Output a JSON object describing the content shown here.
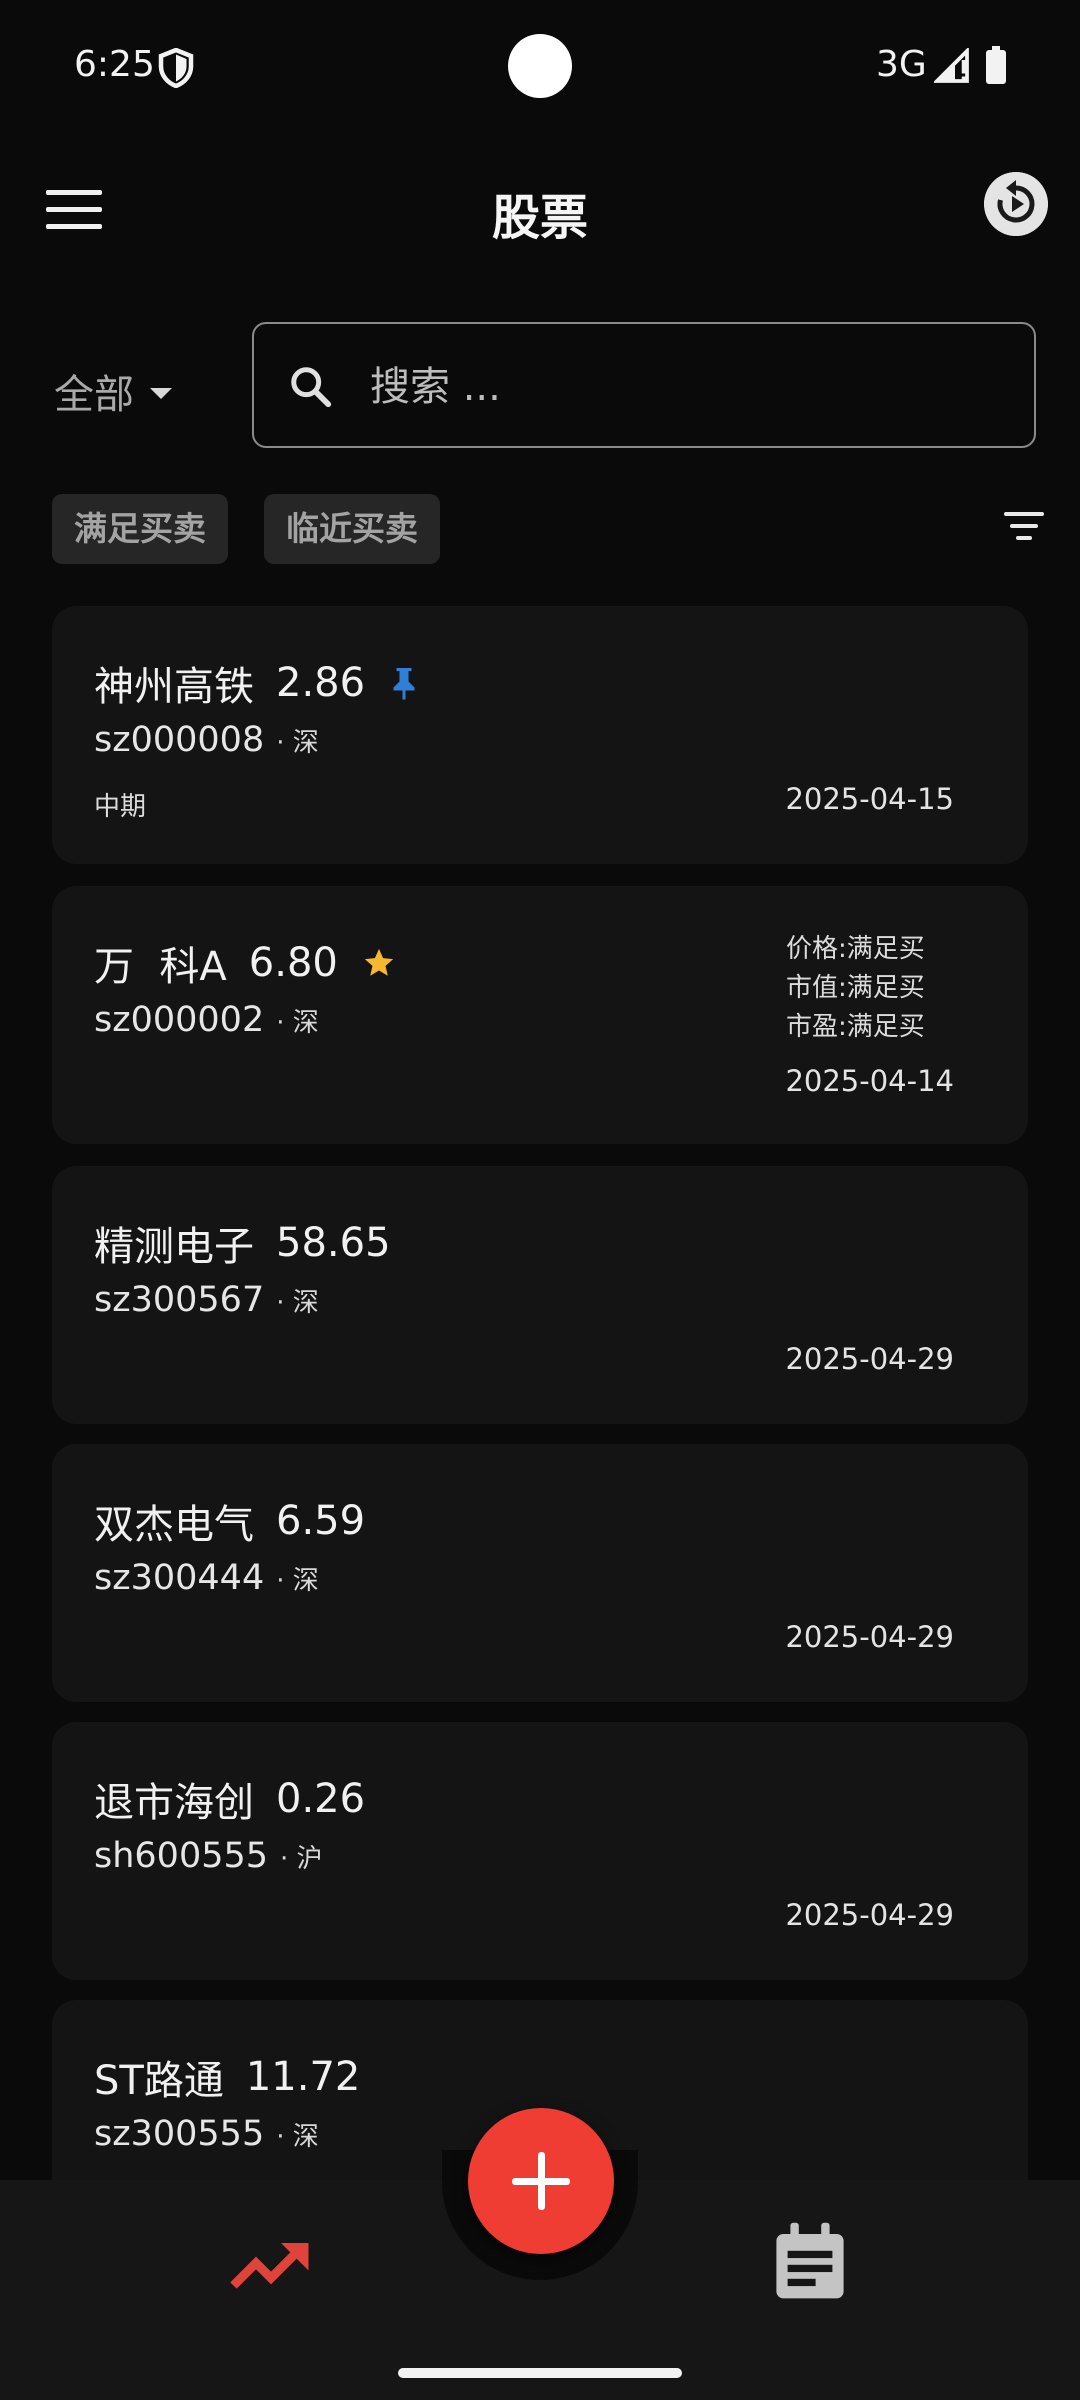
{
  "status_bar": {
    "time": "6:25",
    "network": "3G"
  },
  "app_bar": {
    "title": "股票"
  },
  "filter": {
    "selected": "全部"
  },
  "search": {
    "placeholder": "搜索 ..."
  },
  "chips": [
    {
      "label": "满足买卖"
    },
    {
      "label": "临近买卖"
    }
  ],
  "stocks": [
    {
      "name": "神州高铁",
      "price": "2.86",
      "code": "sz000008",
      "market": "· 深",
      "term": "中期",
      "date": "2025-04-15",
      "badge": "pin-icon"
    },
    {
      "name": "万  科A",
      "price": "6.80",
      "code": "sz000002",
      "market": "· 深",
      "conditions": [
        "价格:满足买",
        "市值:满足买",
        "市盈:满足买"
      ],
      "date": "2025-04-14",
      "badge": "star-icon"
    },
    {
      "name": "精测电子",
      "price": "58.65",
      "code": "sz300567",
      "market": "· 深",
      "date": "2025-04-29"
    },
    {
      "name": "双杰电气",
      "price": "6.59",
      "code": "sz300444",
      "market": "· 深",
      "date": "2025-04-29"
    },
    {
      "name": "退市海创",
      "price": "0.26",
      "code": "sh600555",
      "market": "· 沪",
      "date": "2025-04-29"
    },
    {
      "name": "ST路通",
      "price": "11.72",
      "code": "sz300555",
      "market": "· 深"
    }
  ],
  "colors": {
    "accent": "#ef3d33",
    "pin": "#2f7fd6",
    "star": "#f5b82e",
    "card": "#141414",
    "background": "#0a0a0a"
  },
  "bottom_nav": {
    "items": [
      {
        "icon": "trending-up-icon",
        "active": true
      },
      {
        "icon": "notes-icon",
        "active": false
      }
    ],
    "fab_icon": "plus-icon"
  }
}
